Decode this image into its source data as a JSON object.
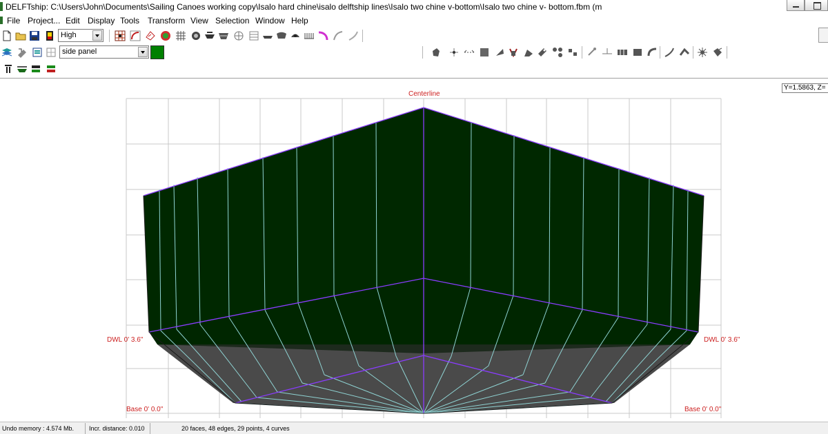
{
  "titlebar": {
    "title": "DELFTship: C:\\Users\\John\\Documents\\Sailing Canoes working copy\\Isalo hard chine\\isalo delftship lines\\Isalo two chine v-bottom\\Isalo two chine v- bottom.fbm (m"
  },
  "menu": {
    "file": "File",
    "project": "Project...",
    "edit": "Edit",
    "display": "Display",
    "tools": "Tools",
    "transform": "Transform",
    "view": "View",
    "selection": "Selection",
    "window": "Window",
    "help": "Help"
  },
  "toolbar": {
    "precision_value": "High",
    "layer_value": "side panel",
    "layer_color": "#008000"
  },
  "viewport": {
    "coord_readout": "Y=1.5863,  Z=",
    "centerline_label": "Centerline",
    "dwl_label_left": "DWL 0' 3.6\"",
    "dwl_label_right": "DWL 0' 3.6\"",
    "base_label_left": "Base 0' 0.0\"",
    "base_label_right": "Base 0' 0.0\"",
    "colors": {
      "hull_above_waterline": "#002800",
      "hull_below_waterline": "#4a4a4a",
      "station_lines": "#8fd3d3",
      "chine_edges": "#8a3cff",
      "grid": "#c8c8c8",
      "labels": "#cc2020"
    }
  },
  "statusbar": {
    "undo_memory": "Undo memory : 4.574 Mb.",
    "incr_distance": "Incr. distance: 0.010",
    "model_stats": "20 faces, 48 edges, 29 points, 4 curves"
  }
}
